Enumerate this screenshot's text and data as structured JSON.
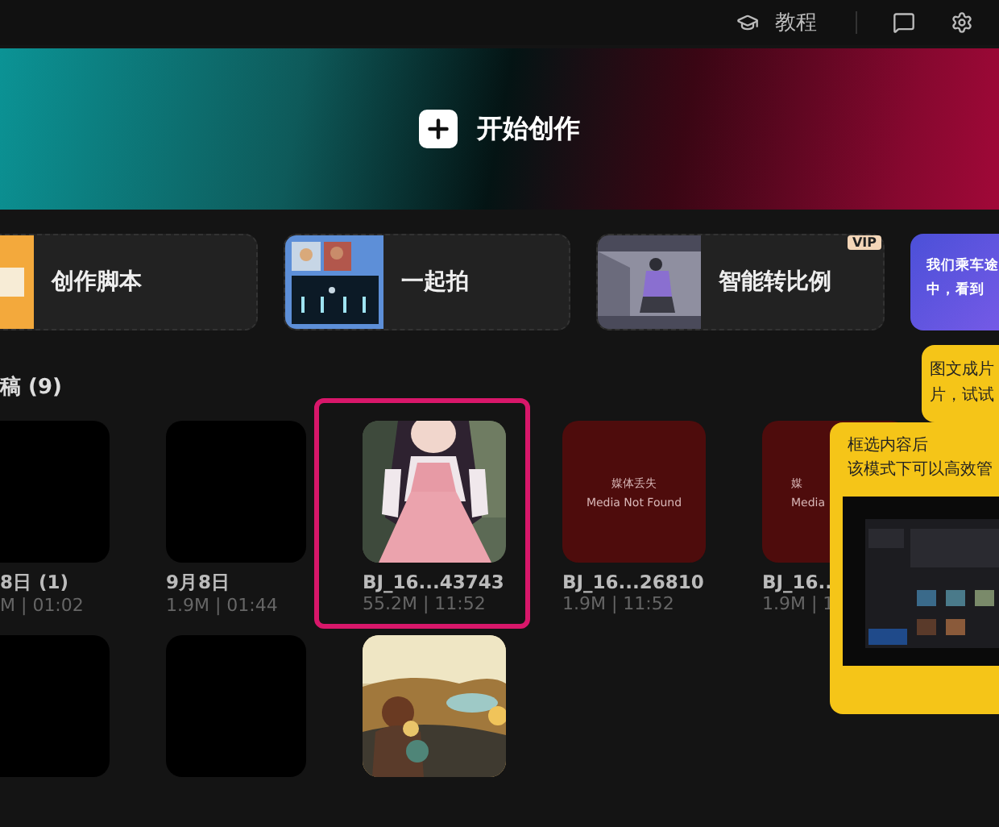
{
  "top_bar": {
    "tutorial_label": "教程"
  },
  "banner": {
    "label": "开始创作"
  },
  "features": [
    {
      "kind": "script",
      "label": "创作脚本"
    },
    {
      "kind": "together",
      "label": "一起拍"
    },
    {
      "kind": "ratio",
      "label": "智能转比例",
      "badge": "VIP"
    },
    {
      "kind": "promo",
      "lines": [
        "我们乘车途",
        "中，看到"
      ]
    }
  ],
  "small_tip": {
    "lines": [
      "图文成片",
      "片，试试"
    ]
  },
  "section": {
    "title": "稿 (9)"
  },
  "drafts": [
    [
      {
        "kind": "blank",
        "title": "8日 (1)",
        "meta": "M | 01:02",
        "selected": false
      },
      {
        "kind": "blank",
        "title": "9月8日",
        "meta": "1.9M | 01:44",
        "selected": false
      },
      {
        "kind": "picture",
        "title": "BJ_16...43743",
        "meta": "55.2M | 11:52",
        "selected": true
      },
      {
        "kind": "missing",
        "missing_cn": "媒体丢失",
        "missing_en": "Media Not Found",
        "title": "BJ_16...26810",
        "meta": "1.9M | 11:52",
        "selected": false
      },
      {
        "kind": "missing",
        "missing_cn": "媒",
        "missing_en": "Media",
        "title": "BJ_16..",
        "meta": "1.9M | 1",
        "selected": false
      }
    ],
    [
      {
        "kind": "blank",
        "selected": false
      },
      {
        "kind": "blank",
        "selected": false
      },
      {
        "kind": "sunset",
        "selected": false
      }
    ]
  ],
  "big_tip": {
    "lines": [
      "框选内容后",
      "该模式下可以高效管"
    ]
  }
}
